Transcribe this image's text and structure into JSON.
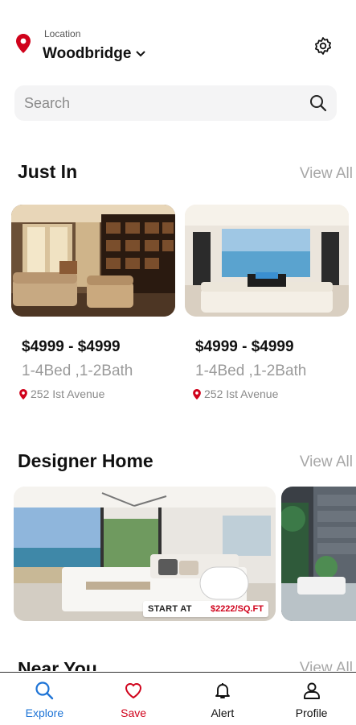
{
  "header": {
    "location_label": "Location",
    "location_value": "Woodbridge"
  },
  "search": {
    "placeholder": "Search"
  },
  "just_in": {
    "title": "Just In",
    "view_all": "View All",
    "cards": [
      {
        "price": "$4999 - $4999",
        "beds": "1-4Bed ,1-2Bath",
        "address": "252 Ist Avenue"
      },
      {
        "price": "$4999 - $4999",
        "beds": "1-4Bed ,1-2Bath",
        "address": "252 Ist Avenue"
      }
    ]
  },
  "designer": {
    "title": "Designer Home",
    "view_all": "View All",
    "badge_label": "START AT",
    "badge_value": "$2222/SQ.FT"
  },
  "near_you": {
    "title": "Near You",
    "view_all": "View All"
  },
  "tabs": [
    {
      "label": "Explore",
      "icon": "search-icon",
      "color": "#1e74d6"
    },
    {
      "label": "Save",
      "icon": "heart-icon",
      "color": "#d0021b"
    },
    {
      "label": "Alert",
      "icon": "bell-icon",
      "color": "#111111"
    },
    {
      "label": "Profile",
      "icon": "user-icon",
      "color": "#111111"
    }
  ],
  "colors": {
    "accent_red": "#d0021b",
    "accent_blue": "#1e74d6",
    "muted": "#a7a7a7"
  }
}
